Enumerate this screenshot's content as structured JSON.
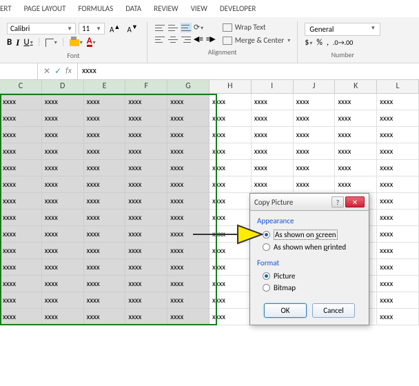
{
  "tabs": [
    "ERT",
    "PAGE LAYOUT",
    "FORMULAS",
    "DATA",
    "REVIEW",
    "VIEW",
    "DEVELOPER"
  ],
  "font": {
    "name": "Calibri",
    "size": "11",
    "bold": "B",
    "italic": "I",
    "underline": "U",
    "fontcolor": "A"
  },
  "group_labels": {
    "font": "Font",
    "alignment": "Alignment",
    "number": "Number"
  },
  "alignment": {
    "wrap": "Wrap Text",
    "merge": "Merge & Center"
  },
  "number": {
    "format": "General"
  },
  "formula_bar": {
    "value": "xxxx",
    "fx": "fx",
    "cancel": "✕",
    "ok": "✓"
  },
  "columns": [
    "C",
    "D",
    "E",
    "F",
    "G",
    "H",
    "I",
    "J",
    "K",
    "L"
  ],
  "chart_data": {
    "type": "table",
    "columns": [
      "C",
      "D",
      "E",
      "F",
      "G",
      "H",
      "I",
      "J",
      "K",
      "L"
    ],
    "rows": 14,
    "cell_value": "xxxx",
    "selection": {
      "cols": [
        "C",
        "D",
        "E",
        "F",
        "G"
      ],
      "all_rows": true
    }
  },
  "cell_value": "xxxx",
  "dialog": {
    "title": "Copy Picture",
    "appearance_label": "Appearance",
    "opt_screen_pre": "As shown on ",
    "opt_screen_u": "s",
    "opt_screen_post": "creen",
    "opt_printed_pre": "As shown when ",
    "opt_printed_u": "p",
    "opt_printed_post": "rinted",
    "format_label": "Format",
    "opt_picture": "Picture",
    "opt_bitmap": "Bitmap",
    "ok": "OK",
    "cancel": "Cancel",
    "help": "?",
    "close": "✕"
  }
}
